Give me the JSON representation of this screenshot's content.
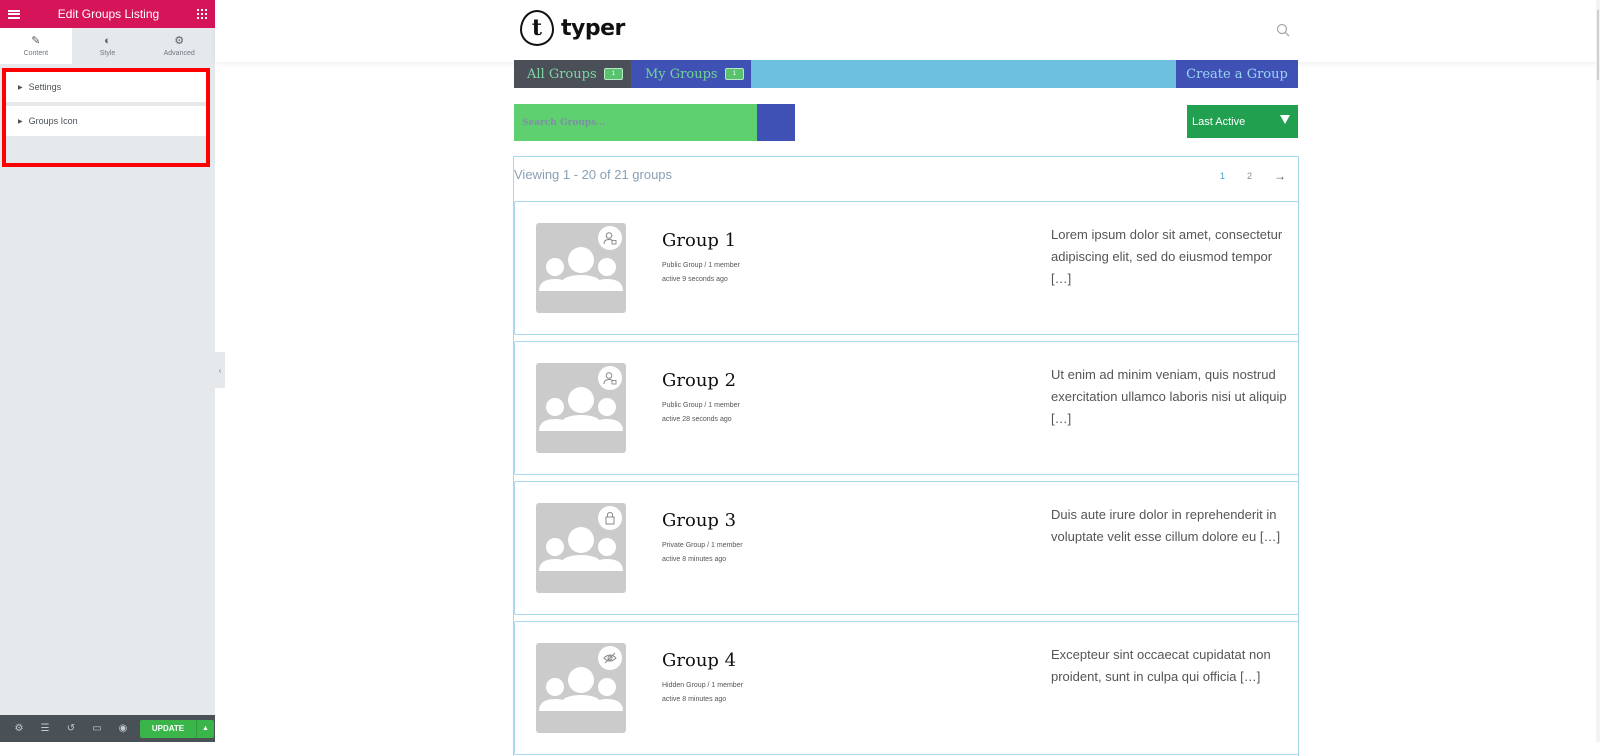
{
  "panel": {
    "title": "Edit Groups Listing",
    "tabs": [
      {
        "label": "Content",
        "icon": "pencil-icon"
      },
      {
        "label": "Style",
        "icon": "contrast-icon"
      },
      {
        "label": "Advanced",
        "icon": "gear-icon"
      }
    ],
    "active_tab": "Content",
    "sections": [
      {
        "label": "Settings"
      },
      {
        "label": "Groups Icon"
      }
    ],
    "footer": {
      "icons": [
        "gear-icon",
        "layers-icon",
        "history-icon",
        "responsive-icon",
        "preview-eye-icon"
      ],
      "update_label": "UPDATE"
    },
    "colors": {
      "header": "#d5145a",
      "update": "#39b54a",
      "highlight": "#ff0000"
    }
  },
  "site": {
    "logo_mark": "t",
    "logo_text": "typer"
  },
  "groups_nav": {
    "tabs": [
      {
        "label": "All Groups",
        "count": "1"
      },
      {
        "label": "My Groups",
        "count": "1"
      }
    ],
    "create_label": "Create a Group"
  },
  "search": {
    "placeholder": "Search Groups..."
  },
  "sort": {
    "selected": "Last Active"
  },
  "listing": {
    "viewing_text": "Viewing 1 - 20 of 21 groups",
    "pagination": {
      "pages": [
        "1",
        "2"
      ],
      "current": "1",
      "next": "→"
    },
    "groups": [
      {
        "name": "Group 1",
        "type": "Public Group / 1 member",
        "active": "active 9 seconds ago",
        "description": "Lorem ipsum dolor sit amet, consectetur adipiscing elit, sed do eiusmod tempor […]",
        "status_icon": "public-user-icon"
      },
      {
        "name": "Group 2",
        "type": "Public Group / 1 member",
        "active": "active 28 seconds ago",
        "description": "Ut enim ad minim veniam, quis nostrud exercitation ullamco laboris nisi ut aliquip […]",
        "status_icon": "public-user-icon"
      },
      {
        "name": "Group 3",
        "type": "Private Group / 1 member",
        "active": "active 8 minutes ago",
        "description": "Duis aute irure dolor in reprehenderit in voluptate velit esse cillum dolore eu […]",
        "status_icon": "lock-icon"
      },
      {
        "name": "Group 4",
        "type": "Hidden Group / 1 member",
        "active": "active 8 minutes ago",
        "description": "Excepteur sint occaecat cupidatat non proident, sunt in culpa qui officia […]",
        "status_icon": "eye-slash-icon"
      }
    ]
  }
}
